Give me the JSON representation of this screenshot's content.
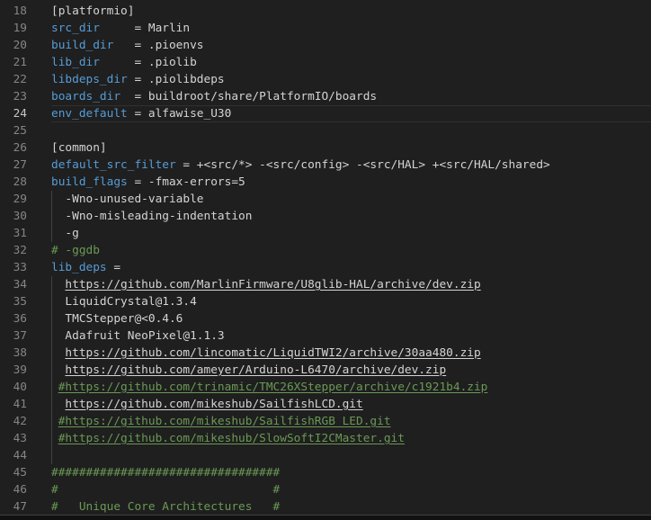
{
  "app": {
    "kind": "code-editor",
    "language": "ini"
  },
  "editor": {
    "active_line": 24,
    "colors": {
      "background": "#1f1f1f",
      "foreground": "#d4d4d4",
      "key": "#569cd6",
      "comment": "#6a9955",
      "line_number": "#858585",
      "active_line_number": "#c6c6c6",
      "active_line_border": "#303030",
      "indent_guide": "#404040",
      "bottom_bar_background": "#111111",
      "bottom_bar_border": "#424242"
    },
    "lines": [
      {
        "num": 18,
        "spans": [
          {
            "t": "[platformio]",
            "c": "text"
          }
        ]
      },
      {
        "num": 19,
        "spans": [
          {
            "t": "src_dir",
            "c": "key"
          },
          {
            "t": "     = Marlin",
            "c": "text"
          }
        ]
      },
      {
        "num": 20,
        "spans": [
          {
            "t": "build_dir",
            "c": "key"
          },
          {
            "t": "   = .pioenvs",
            "c": "text"
          }
        ]
      },
      {
        "num": 21,
        "spans": [
          {
            "t": "lib_dir",
            "c": "key"
          },
          {
            "t": "     = .piolib",
            "c": "text"
          }
        ]
      },
      {
        "num": 22,
        "spans": [
          {
            "t": "libdeps_dir",
            "c": "key"
          },
          {
            "t": " = .piolibdeps",
            "c": "text"
          }
        ]
      },
      {
        "num": 23,
        "spans": [
          {
            "t": "boards_dir",
            "c": "key"
          },
          {
            "t": "  = buildroot/share/PlatformIO/boards",
            "c": "text"
          }
        ]
      },
      {
        "num": 24,
        "spans": [
          {
            "t": "env_default",
            "c": "key"
          },
          {
            "t": " = alfawise_U30",
            "c": "text"
          }
        ]
      },
      {
        "num": 25,
        "spans": []
      },
      {
        "num": 26,
        "spans": [
          {
            "t": "[common]",
            "c": "text"
          }
        ]
      },
      {
        "num": 27,
        "spans": [
          {
            "t": "default_src_filter",
            "c": "key"
          },
          {
            "t": " = +<src/*> -<src/config> -<src/HAL> +<src/HAL/shared>",
            "c": "text"
          }
        ]
      },
      {
        "num": 28,
        "spans": [
          {
            "t": "build_flags",
            "c": "key"
          },
          {
            "t": " = -fmax-errors=5",
            "c": "text"
          }
        ]
      },
      {
        "num": 29,
        "guide": true,
        "spans": [
          {
            "t": "  -Wno-unused-variable",
            "c": "text"
          }
        ]
      },
      {
        "num": 30,
        "guide": true,
        "spans": [
          {
            "t": "  -Wno-misleading-indentation",
            "c": "text"
          }
        ]
      },
      {
        "num": 31,
        "guide": true,
        "spans": [
          {
            "t": "  -g",
            "c": "text"
          }
        ]
      },
      {
        "num": 32,
        "spans": [
          {
            "t": "# -ggdb",
            "c": "comment"
          }
        ]
      },
      {
        "num": 33,
        "spans": [
          {
            "t": "lib_deps",
            "c": "key"
          },
          {
            "t": " =",
            "c": "text"
          }
        ]
      },
      {
        "num": 34,
        "guide": true,
        "spans": [
          {
            "t": "  ",
            "c": "text"
          },
          {
            "t": "https://github.com/MarlinFirmware/U8glib-HAL/archive/dev.zip",
            "c": "text",
            "u": true
          }
        ]
      },
      {
        "num": 35,
        "guide": true,
        "spans": [
          {
            "t": "  LiquidCrystal@1.3.4",
            "c": "text"
          }
        ]
      },
      {
        "num": 36,
        "guide": true,
        "spans": [
          {
            "t": "  TMCStepper@<0.4.6",
            "c": "text"
          }
        ]
      },
      {
        "num": 37,
        "guide": true,
        "spans": [
          {
            "t": "  Adafruit NeoPixel@1.1.3",
            "c": "text"
          }
        ]
      },
      {
        "num": 38,
        "guide": true,
        "spans": [
          {
            "t": "  ",
            "c": "text"
          },
          {
            "t": "https://github.com/lincomatic/LiquidTWI2/archive/30aa480.zip",
            "c": "text",
            "u": true
          }
        ]
      },
      {
        "num": 39,
        "guide": true,
        "spans": [
          {
            "t": "  ",
            "c": "text"
          },
          {
            "t": "https://github.com/ameyer/Arduino-L6470/archive/dev.zip",
            "c": "text",
            "u": true
          }
        ]
      },
      {
        "num": 40,
        "guide": true,
        "spans": [
          {
            "t": " ",
            "c": "text"
          },
          {
            "t": "#https://github.com/trinamic/TMC26XStepper/archive/c1921b4.zip",
            "c": "comment",
            "u": true
          }
        ]
      },
      {
        "num": 41,
        "guide": true,
        "spans": [
          {
            "t": "  ",
            "c": "text"
          },
          {
            "t": "https://github.com/mikeshub/SailfishLCD.git",
            "c": "text",
            "u": true
          }
        ]
      },
      {
        "num": 42,
        "guide": true,
        "spans": [
          {
            "t": " ",
            "c": "text"
          },
          {
            "t": "#https://github.com/mikeshub/SailfishRGB_LED.git",
            "c": "comment",
            "u": true
          }
        ]
      },
      {
        "num": 43,
        "guide": true,
        "spans": [
          {
            "t": " ",
            "c": "text"
          },
          {
            "t": "#https://github.com/mikeshub/SlowSoftI2CMaster.git",
            "c": "comment",
            "u": true
          }
        ]
      },
      {
        "num": 44,
        "guide": true,
        "spans": []
      },
      {
        "num": 45,
        "spans": [
          {
            "t": "#################################",
            "c": "comment"
          }
        ]
      },
      {
        "num": 46,
        "spans": [
          {
            "t": "#                               #",
            "c": "comment"
          }
        ]
      },
      {
        "num": 47,
        "spans": [
          {
            "t": "#   Unique Core Architectures   #",
            "c": "comment"
          }
        ]
      }
    ]
  }
}
